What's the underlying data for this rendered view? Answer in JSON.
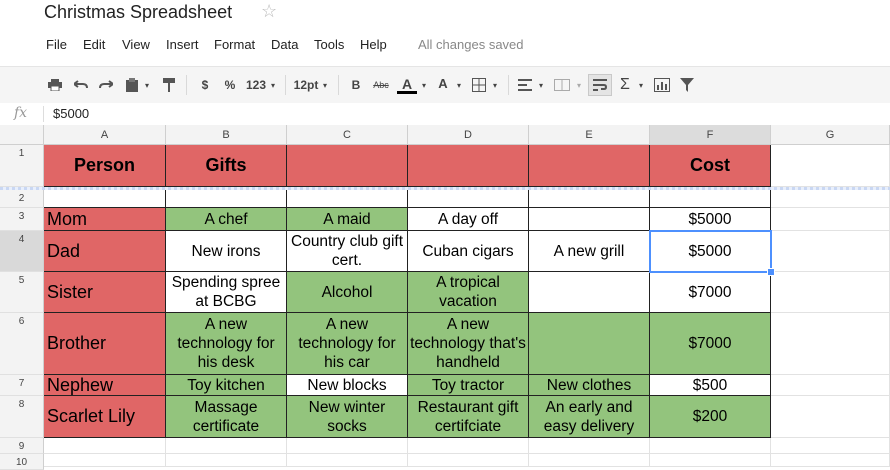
{
  "doc": {
    "title": "Christmas Spreadsheet",
    "star_icon": "star-icon"
  },
  "menu": {
    "items": [
      "File",
      "Edit",
      "View",
      "Insert",
      "Format",
      "Data",
      "Tools",
      "Help"
    ],
    "status": "All changes saved"
  },
  "toolbar": {
    "currency": "$",
    "percent": "%",
    "number_format": "123",
    "font_size": "12pt",
    "bold": "B",
    "strikethrough": "Abc",
    "text_color": "A",
    "fill_color": "A",
    "sigma": "Σ"
  },
  "formula": {
    "fx": "fx",
    "value": "$5000"
  },
  "columns": [
    "A",
    "B",
    "C",
    "D",
    "E",
    "F",
    "G"
  ],
  "selected_column": "F",
  "rows": [
    "1",
    "2",
    "3",
    "4",
    "5",
    "6",
    "7",
    "8",
    "9",
    "10"
  ],
  "selected_row": "4",
  "colors": {
    "header_red": "#e06666",
    "green": "#93c47d",
    "selection": "#4d90fe"
  },
  "sheet": {
    "header": {
      "person": "Person",
      "gifts": "Gifts",
      "cost": "Cost"
    },
    "people": [
      {
        "name": "Mom",
        "gifts": [
          "A chef",
          "A maid",
          "A day off",
          ""
        ],
        "cost": "$5000"
      },
      {
        "name": "Dad",
        "gifts": [
          "New irons",
          "Country club gift cert.",
          "Cuban cigars",
          "A new grill"
        ],
        "cost": "$5000"
      },
      {
        "name": "Sister",
        "gifts": [
          "Spending spree at BCBG",
          "Alcohol",
          "A tropical vacation",
          ""
        ],
        "cost": "$7000"
      },
      {
        "name": "Brother",
        "gifts": [
          "A new technology for his desk",
          "A new technology for his car",
          "A new technology that's handheld",
          ""
        ],
        "cost": "$7000"
      },
      {
        "name": "Nephew",
        "gifts": [
          "Toy kitchen",
          "New blocks",
          "Toy tractor",
          "New clothes"
        ],
        "cost": "$500"
      },
      {
        "name": "Scarlet Lily",
        "gifts": [
          "Massage certificate",
          "New winter socks",
          "Restaurant gift certifciate",
          "An early and easy delivery"
        ],
        "cost": "$200"
      }
    ]
  }
}
